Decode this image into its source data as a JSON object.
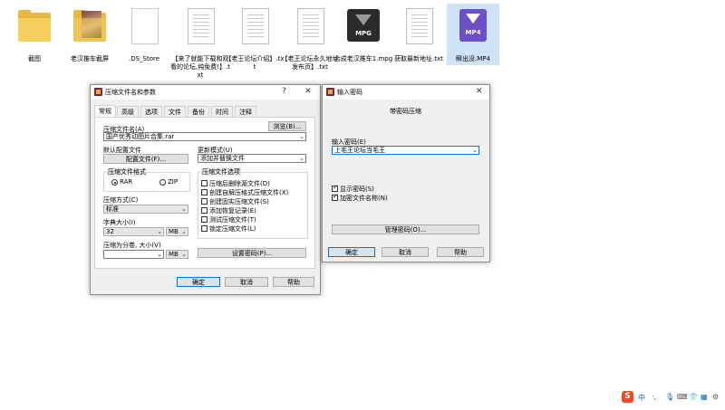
{
  "desktop": {
    "files": [
      {
        "name": "截图",
        "icon": "folder-icon"
      },
      {
        "name": "老汉推车截屏",
        "icon": "folder-photos-icon"
      },
      {
        "name": ".DS_Store",
        "icon": "file-icon"
      },
      {
        "name": "【来了就能下载和观看的论坛,纯免费!】.txt",
        "icon": "text-file-icon"
      },
      {
        "name": "【老王论坛介绍】.txt",
        "icon": "text-file-icon"
      },
      {
        "name": "【老王论坛永久地址发布页】.txt",
        "icon": "text-file-icon"
      },
      {
        "name": "合成老汉推车1.mpg",
        "icon": "mpg-video-icon",
        "badge": "MPG"
      },
      {
        "name": "获取最新地址.txt",
        "icon": "text-file-icon"
      },
      {
        "name": "瞬出没.MP4",
        "icon": "mp4-video-icon",
        "badge": "MP4"
      }
    ]
  },
  "archive_dialog": {
    "title": "压缩文件名和参数",
    "help_btn": "?",
    "close_btn": "✕",
    "tabs": [
      "常规",
      "高级",
      "选项",
      "文件",
      "备份",
      "时间",
      "注释"
    ],
    "archive_name_label": "压缩文件名(A)",
    "browse_btn": "浏览(B)...",
    "archive_name_value": "国产优秀动图片合集.rar",
    "default_config_label": "默认配置文件",
    "config_btn": "配置文件(F)...",
    "update_mode_label": "更新模式(U)",
    "update_mode_value": "添加并替换文件",
    "format_group": "压缩文件格式",
    "format_rar": "RAR",
    "format_zip": "ZIP",
    "method_label": "压缩方式(C)",
    "method_value": "标准",
    "dict_label": "字典大小(I)",
    "dict_value": "32",
    "dict_unit": "MB",
    "split_label": "压缩为分卷, 大小(V)",
    "split_value": "",
    "split_unit": "MB",
    "options_group": "压缩文件选项",
    "options": [
      {
        "label": "压缩后删除源文件(D)",
        "checked": false
      },
      {
        "label": "创建自解压格式压缩文件(X)",
        "checked": false
      },
      {
        "label": "创建固实压缩文件(S)",
        "checked": false
      },
      {
        "label": "添加恢复记录(E)",
        "checked": false
      },
      {
        "label": "测试压缩文件(T)",
        "checked": false
      },
      {
        "label": "锁定压缩文件(L)",
        "checked": false
      }
    ],
    "set_password_btn": "设置密码(P)...",
    "ok_btn": "确定",
    "cancel_btn": "取消",
    "help_action_btn": "帮助"
  },
  "password_dialog": {
    "title": "输入密码",
    "close_btn": "✕",
    "heading": "带密码压缩",
    "password_label": "输入密码(E)",
    "password_value": "上毛王论坛当毛王",
    "show_password_label": "显示密码(S)",
    "show_password_checked": true,
    "encrypt_names_label": "加密文件名称(N)",
    "encrypt_names_checked": true,
    "manage_btn": "管理密码(O)...",
    "ok_btn": "确定",
    "cancel_btn": "取消",
    "help_btn": "帮助"
  },
  "tray": {
    "ime_logo": "S",
    "ime_lang": "中",
    "punct": "·,",
    "colors": {
      "sogou": "#e84c22",
      "accent": "#0078d7"
    }
  }
}
